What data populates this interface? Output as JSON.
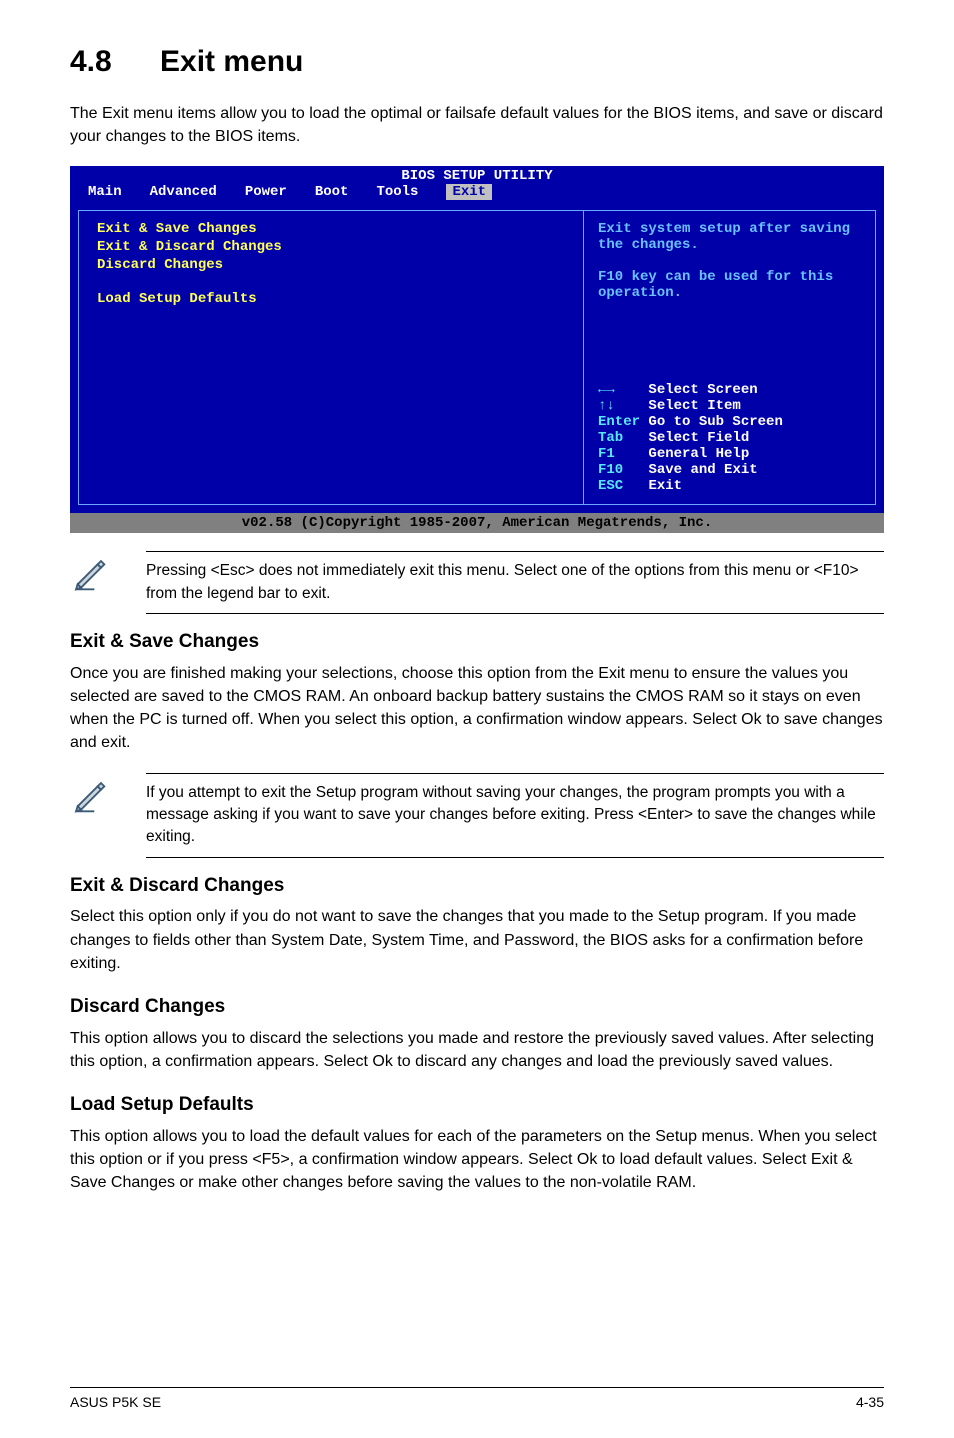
{
  "heading": {
    "number": "4.8",
    "title": "Exit menu"
  },
  "intro": "The Exit menu items allow you to load the optimal or failsafe default values for the BIOS items, and save or discard your changes to the BIOS items.",
  "bios": {
    "title": "BIOS SETUP UTILITY",
    "menubar": [
      "Main",
      "Advanced",
      "Power",
      "Boot",
      "Tools",
      "Exit"
    ],
    "active": "Exit",
    "left": {
      "items": [
        "Exit & Save Changes",
        "Exit & Discard Changes",
        "Discard Changes",
        "",
        "Load Setup Defaults"
      ]
    },
    "help": "Exit system setup after saving the changes.\n\nF10 key can be used for this operation.",
    "nav": [
      {
        "key": "←→",
        "label": "Select Screen"
      },
      {
        "key": "↑↓",
        "label": "Select Item"
      },
      {
        "key": "Enter",
        "label": "Go to Sub Screen"
      },
      {
        "key": "Tab",
        "label": "Select Field"
      },
      {
        "key": "F1",
        "label": "General Help"
      },
      {
        "key": "F10",
        "label": "Save and Exit"
      },
      {
        "key": "ESC",
        "label": "Exit"
      }
    ],
    "footer": "v02.58 (C)Copyright 1985-2007, American Megatrends, Inc."
  },
  "note1": "Pressing <Esc> does not immediately exit this menu. Select one of the options from this menu or <F10> from the legend bar to exit.",
  "sections": [
    {
      "title": "Exit & Save Changes",
      "body": "Once you are finished making your selections, choose this option from the Exit menu to ensure the values you selected are saved to the CMOS RAM. An onboard backup battery sustains the CMOS RAM so it stays on even when the PC is turned off. When you select this option, a confirmation window appears. Select Ok to save changes and exit."
    }
  ],
  "note2": " If you attempt to exit the Setup program without saving your changes, the program prompts you with a message asking if you want to save your changes before exiting. Press <Enter>  to save the  changes while exiting.",
  "sections2": [
    {
      "title": "Exit & Discard Changes",
      "body": "Select this option only if you do not want to save the changes that you  made to the Setup program. If you made changes to fields other than System Date, System Time, and Password, the BIOS asks for a confirmation before exiting."
    },
    {
      "title": "Discard Changes",
      "body": "This option allows you to discard the selections you made and restore the previously saved values. After selecting this option, a confirmation appears. Select Ok to discard any changes and load the previously saved values."
    },
    {
      "title": "Load Setup Defaults",
      "body": "This option allows you to load the default values for each of the parameters on the Setup menus. When you select this option or if you press <F5>, a confirmation window appears. Select Ok to load default values. Select Exit & Save Changes or make other changes before saving the values to the non-volatile RAM."
    }
  ],
  "footer": {
    "left": "ASUS P5K SE",
    "right": "4-35"
  }
}
